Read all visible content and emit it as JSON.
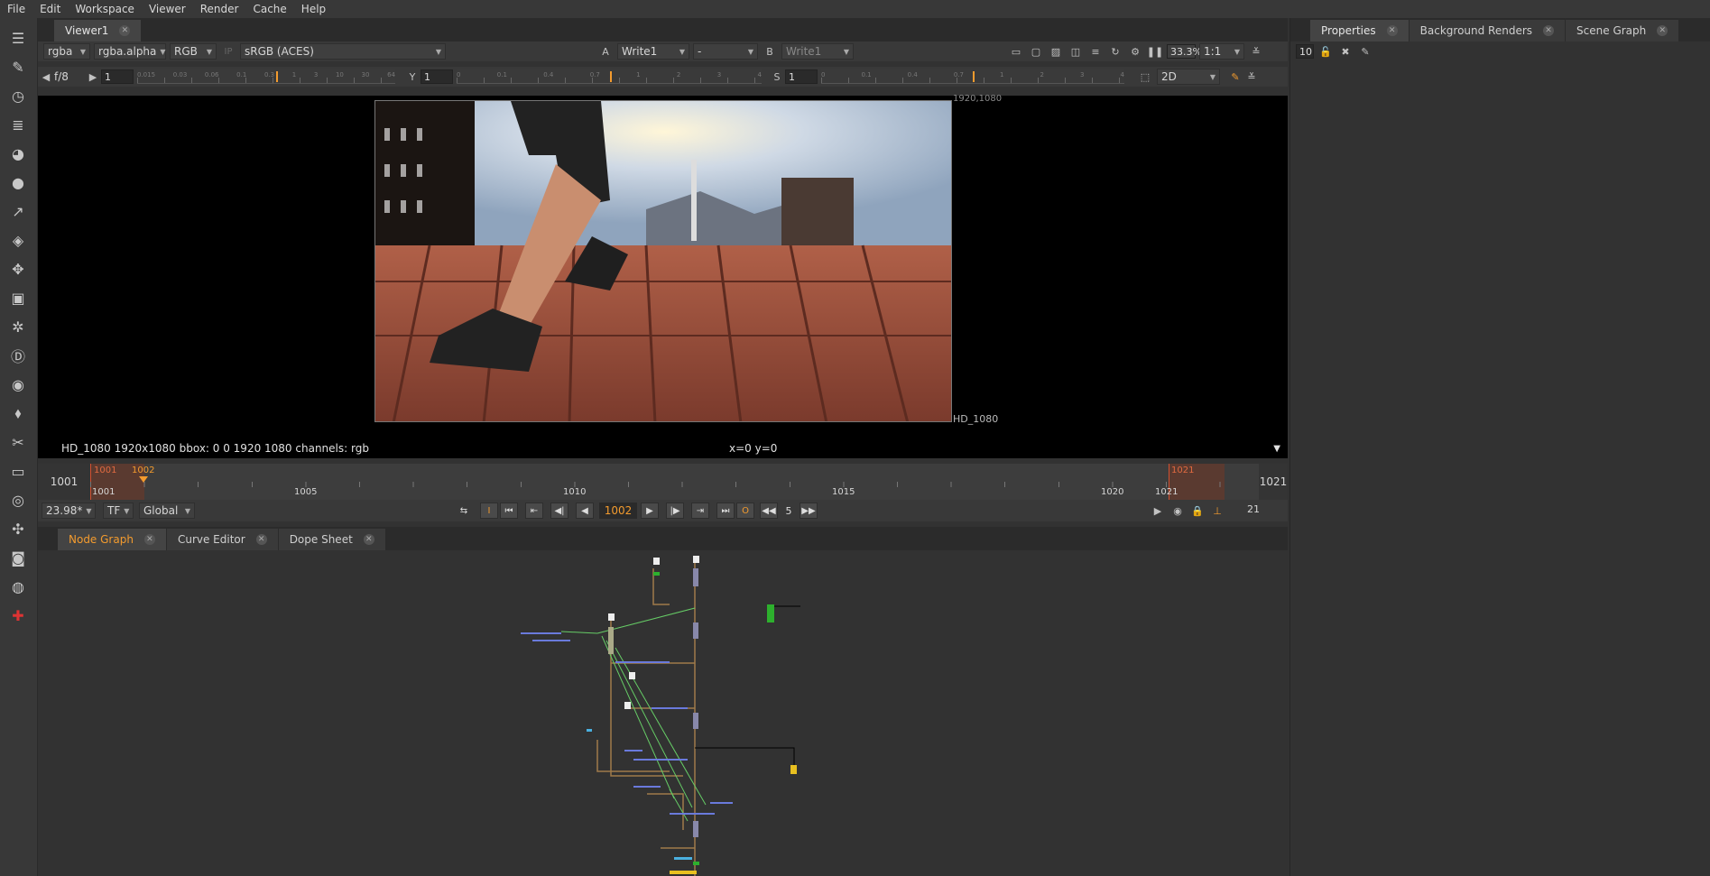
{
  "menu": [
    "File",
    "Edit",
    "Workspace",
    "Viewer",
    "Render",
    "Cache",
    "Help"
  ],
  "viewer_tab": {
    "label": "Viewer1"
  },
  "viewer_controls": {
    "channels": "rgba",
    "alpha": "rgba.alpha",
    "rgb": "RGB",
    "ip": "IP",
    "colorspace": "sRGB (ACES)",
    "a_label": "A",
    "a_input": "Write1",
    "compare": "-",
    "b_label": "B",
    "b_input": "Write1",
    "zoom": "33.3%",
    "ratio": "1:1"
  },
  "gain_row": {
    "fstop": "f/8",
    "gain_value": "1",
    "gain_ticks": [
      "0.015",
      "0.03",
      "0.06",
      "0.1",
      "0.3",
      "1",
      "3",
      "10",
      "30",
      "64"
    ],
    "y_label": "Y",
    "y_value": "1",
    "y_ticks": [
      "0",
      "0.1",
      "0.4",
      "0.7",
      "1",
      "2",
      "3",
      "4"
    ],
    "s_label": "S",
    "s_value": "1",
    "s_ticks": [
      "0",
      "0.1",
      "0.4",
      "0.7",
      "1",
      "2",
      "3",
      "4"
    ],
    "view_mode": "2D"
  },
  "canvas": {
    "top_right_label": "1920,1080",
    "format_label": "HD_1080"
  },
  "info_bar": {
    "format_info": "HD_1080 1920x1080  bbox: 0 0 1920 1080 channels: rgb",
    "coords": "x=0 y=0"
  },
  "timeline": {
    "start": "1001",
    "end": "1021",
    "in_marker": "1001",
    "current_marker": "1002",
    "out_marker": "1021",
    "ticks": [
      "1001",
      "1005",
      "1010",
      "1015",
      "1020",
      "1021"
    ]
  },
  "transport": {
    "fps": "23.98*",
    "tf": "TF",
    "scope": "Global",
    "current_frame": "1002",
    "step": "5",
    "frame_count": "21"
  },
  "bottom_tabs": [
    "Node Graph",
    "Curve Editor",
    "Dope Sheet"
  ],
  "right_tabs": [
    "Properties",
    "Background Renders",
    "Scene Graph"
  ],
  "properties": {
    "max_panels": "10"
  },
  "colors": {
    "accent": "#f39b2e",
    "background": "#323232"
  }
}
